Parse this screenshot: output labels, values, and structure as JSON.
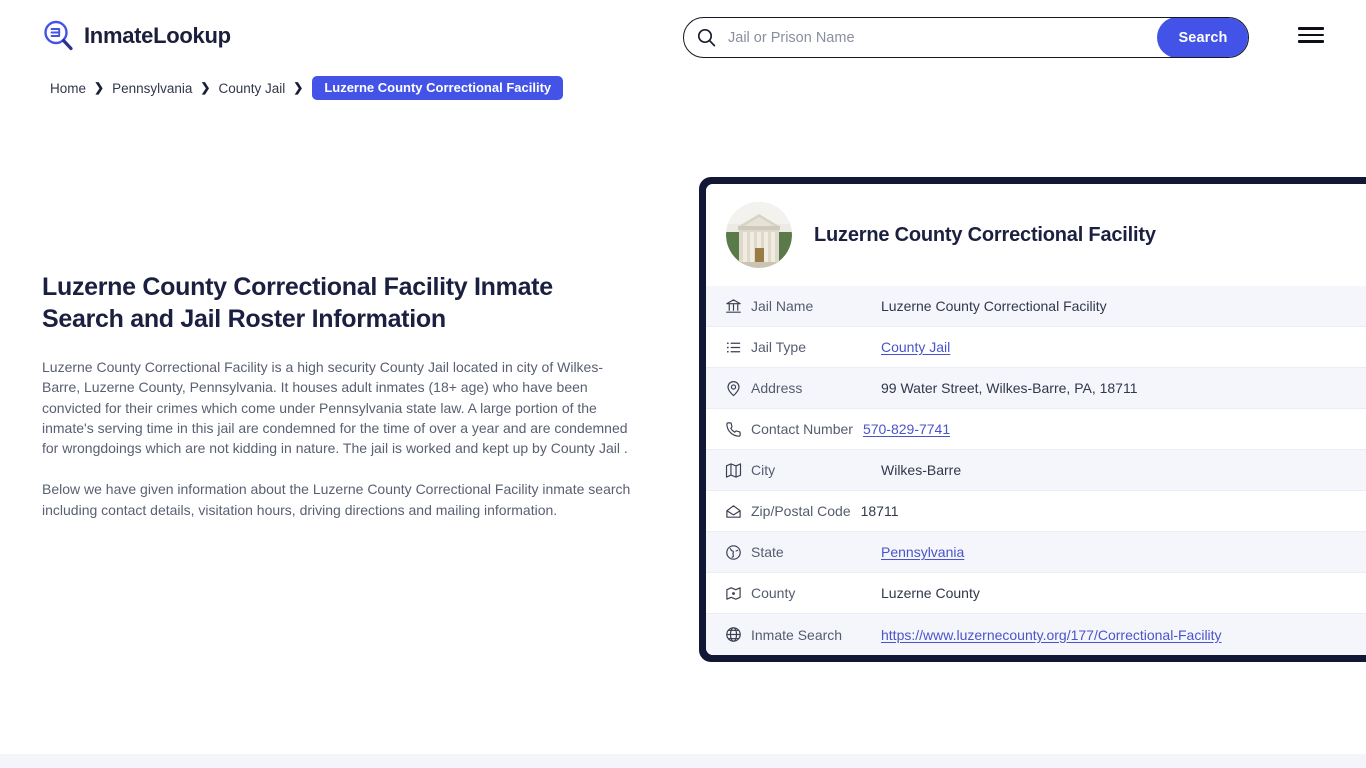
{
  "header": {
    "brand_name": "InmateLookup",
    "brand_icon": "magnifier-list-icon",
    "search": {
      "placeholder": "Jail or Prison Name",
      "value": "",
      "icon": "search-icon",
      "button_label": "Search"
    },
    "menu_icon": "hamburger-menu-icon"
  },
  "breadcrumb": {
    "items": [
      {
        "label": "Home",
        "current": false
      },
      {
        "label": "Pennsylvania",
        "current": false
      },
      {
        "label": "County Jail",
        "current": false
      },
      {
        "label": "Luzerne County Correctional Facility",
        "current": true
      }
    ],
    "separator": "❯"
  },
  "main": {
    "title": "Luzerne County Correctional Facility Inmate Search and Jail Roster Information",
    "paragraphs": [
      "Luzerne County Correctional Facility is a high security County Jail located in city of Wilkes-Barre, Luzerne County, Pennsylvania. It houses adult inmates (18+ age) who have been convicted for their crimes which come under Pennsylvania state law. A large portion of the inmate's serving time in this jail are condemned for the time of over a year and are condemned for wrongdoings which are not kidding in nature. The jail is worked and kept up by County Jail .",
      "Below we have given information about the Luzerne County Correctional Facility inmate search including contact details, visitation hours, driving directions and mailing information."
    ]
  },
  "card": {
    "avatar_alt": "courthouse-building-photo",
    "title": "Luzerne County Correctional Facility",
    "rows": [
      {
        "icon": "bank-icon",
        "label": "Jail Name",
        "value": "Luzerne County Correctional Facility",
        "link": false
      },
      {
        "icon": "list-icon",
        "label": "Jail Type",
        "value": "County Jail",
        "link": true
      },
      {
        "icon": "location-pin-icon",
        "label": "Address",
        "value": "99 Water Street, Wilkes-Barre, PA, 18711",
        "link": false
      },
      {
        "icon": "phone-icon",
        "label": "Contact Number",
        "value": "570-829-7741",
        "link": true
      },
      {
        "icon": "map-icon",
        "label": "City",
        "value": "Wilkes-Barre",
        "link": false
      },
      {
        "icon": "envelope-icon",
        "label": "Zip/Postal Code",
        "value": "18711",
        "link": false
      },
      {
        "icon": "globe-circle-icon",
        "label": "State",
        "value": "Pennsylvania",
        "link": true
      },
      {
        "icon": "map-pin-icon",
        "label": "County",
        "value": "Luzerne County",
        "link": false
      },
      {
        "icon": "web-globe-icon",
        "label": "Inmate Search",
        "value": "https://www.luzernecounty.org/177/Correctional-Facility",
        "link": true
      }
    ]
  },
  "colors": {
    "accent": "#4353e8",
    "card_border": "#111734",
    "link": "#4a54c9",
    "title": "#1b2040",
    "body_text": "#596072",
    "row_alt": "#f5f6fc"
  }
}
